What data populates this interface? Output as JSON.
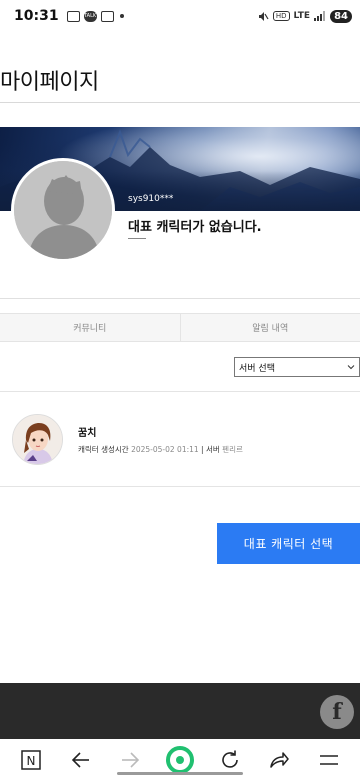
{
  "status_bar": {
    "time": "10:31",
    "talk_icon_text": "TALK",
    "network": "LTE",
    "hd": "HD",
    "battery": "84"
  },
  "page": {
    "title": "마이페이지"
  },
  "profile": {
    "username": "sys910***",
    "no_character_text": "대표 캐릭터가 없습니다."
  },
  "tabs": [
    {
      "label": "커뮤니티"
    },
    {
      "label": "알림 내역"
    }
  ],
  "server_select": {
    "selected": "서버 선택"
  },
  "character": {
    "name": "꿈치",
    "created_label": "캐릭터 생성시간",
    "created_value": "2025-05-02 01:11",
    "separator": " | ",
    "server_label": "서버",
    "server_value": "펜리르"
  },
  "actions": {
    "select_character_label": "대표 캐릭터 선택"
  },
  "browser_bar": {
    "home_label": "N"
  },
  "colors": {
    "primary_button": "#2b7bf3",
    "footer": "#2a2a2a",
    "browser_center": "#20c070"
  },
  "icons": [
    "screen-capture-icon",
    "kakaotalk-icon",
    "cast-icon",
    "mute-icon",
    "signal-icon",
    "facebook-icon",
    "back-icon",
    "forward-icon",
    "refresh-icon",
    "share-icon",
    "menu-icon"
  ]
}
